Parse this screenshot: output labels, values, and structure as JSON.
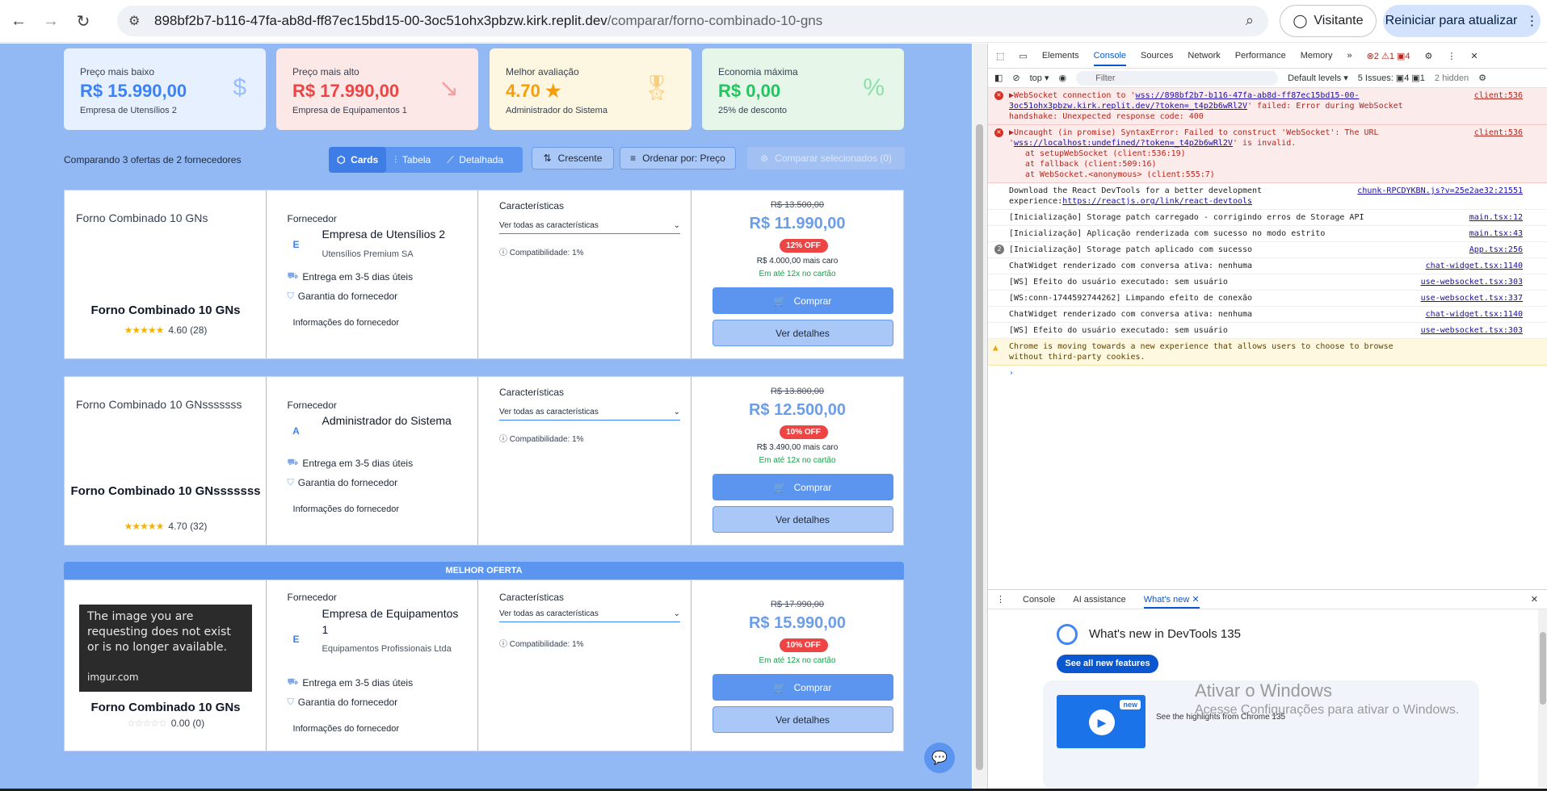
{
  "browser": {
    "url_host": "898bf2b7-b116-47fa-ab8d-ff87ec15bd15-00-3oc51ohx3pbzw.kirk.replit.dev",
    "url_path": "/comparar/forno-combinado-10-gns",
    "visitor_label": "Visitante",
    "restart_label": "Reiniciar para atualizar"
  },
  "stats": [
    {
      "label": "Preço mais baixo",
      "value": "R$ 15.990,00",
      "sub": "Empresa de Utensílios 2",
      "icon": "$",
      "color": "#3b82f6",
      "bg": "#e7f0fe"
    },
    {
      "label": "Preço mais alto",
      "value": "R$ 17.990,00",
      "sub": "Empresa de Equipamentos 1",
      "icon": "↘",
      "color": "#ef4444",
      "bg": "#fde8e8"
    },
    {
      "label": "Melhor avaliação",
      "value": "4.70 ★",
      "sub": "Administrador do Sistema",
      "icon": "🎖",
      "color": "#f59e0b",
      "bg": "#fdf6e0"
    },
    {
      "label": "Economia máxima",
      "value": "R$ 0,00",
      "sub": "25% de desconto",
      "icon": "%",
      "color": "#22c55e",
      "bg": "#e6f7ea"
    }
  ],
  "toolbar": {
    "summary": "Comparando 3 ofertas de 2 fornecedores",
    "view_cards": "Cards",
    "view_table": "Tabela",
    "view_detailed": "Detalhada",
    "sort_dir": "Crescente",
    "sort_by": "Ordenar por: Preço",
    "compare_selected": "Comparar selecionados (0)"
  },
  "labels": {
    "supplier": "Fornecedor",
    "characteristics": "Características",
    "see_all_chars": "Ver todas as características",
    "delivery": "Entrega em 3-5 dias úteis",
    "warranty": "Garantia do fornecedor",
    "supplier_info": "Informações do fornecedor",
    "buy": "Comprar",
    "details": "Ver detalhes",
    "best_offer": "MELHOR OFERTA"
  },
  "offers": [
    {
      "img_alt": "Forno Combinado 10 GNs",
      "name": "Forno Combinado 10 GNs",
      "rating": "4.60 (28)",
      "rating_value": 4.6,
      "initial": "E",
      "company": "Empresa de Utensílios 2",
      "company_sub": "Utensílios Premium SA",
      "compat": "Compatibilidade: 1%",
      "old_price": "R$ 13.500,00",
      "price": "R$ 11.990,00",
      "off": "12% OFF",
      "diff": "R$ 4.000,00 mais caro",
      "installments": "Em até 12x no cartão"
    },
    {
      "img_alt": "Forno Combinado 10 GNsssssss",
      "name": "Forno Combinado 10 GNsssssss",
      "rating": "4.70 (32)",
      "rating_value": 4.7,
      "initial": "A",
      "company": "Administrador do Sistema",
      "company_sub": "",
      "compat": "Compatibilidade: 1%",
      "old_price": "R$ 13.800,00",
      "price": "R$ 12.500,00",
      "off": "10% OFF",
      "diff": "R$ 3.490,00 mais caro",
      "installments": "Em até 12x no cartão"
    },
    {
      "img_text": "The image you are requesting does not exist or is no longer available.",
      "img_site": "imgur.com",
      "name": "Forno Combinado 10 GNs",
      "rating": "0.00 (0)",
      "rating_value": 0,
      "initial": "E",
      "company": "Empresa de Equipamentos 1",
      "company_sub": "Equipamentos Profissionais Ltda",
      "compat": "Compatibilidade: 1%",
      "old_price": "R$ 17.990,00",
      "price": "R$ 15.990,00",
      "off": "10% OFF",
      "installments": "Em até 12x no cartão"
    }
  ],
  "devtools": {
    "tabs": [
      "Elements",
      "Console",
      "Sources",
      "Network",
      "Performance",
      "Memory"
    ],
    "counts": "⊗2 ⚠1 ▣4",
    "context": "top",
    "filter_placeholder": "Filter",
    "levels": "Default levels",
    "issues": "5 Issues: ▣4 ▣1",
    "hidden": "2 hidden",
    "logs": [
      {
        "type": "err",
        "text": "▶WebSocket connection to '",
        "link": "wss://898bf2b7-b116-47fa-ab8d-ff87ec15bd15-00-3oc51ohx3pbzw.kirk.replit.dev/?token=_t4p2b6wRl2V",
        "text2": "' failed: Error during WebSocket handshake: Unexpected response code: 400",
        "src": "client:536"
      },
      {
        "type": "err",
        "text": "▶Uncaught (in promise) SyntaxError: Failed to construct 'WebSocket': The URL '",
        "link": "wss://localhost:undefined/?token=_t4p2b6wRl2V",
        "text2": "' is invalid.",
        "stack": [
          "at setupWebSocket (client:536:19)",
          "at fallback (client:509:16)",
          "at WebSocket.<anonymous> (client:555:7)"
        ],
        "src": "client:536"
      },
      {
        "type": "info",
        "text": "Download the React DevTools for a better development experience:",
        "link": "https://reactjs.org/link/react-devtools",
        "src": "chunk-RPCDYKBN.js?v=25e2ae32:21551"
      },
      {
        "type": "info",
        "text": "[Inicialização] Storage patch carregado - corrigindo erros de Storage API",
        "src": "main.tsx:12"
      },
      {
        "type": "info",
        "text": "[Inicialização] Aplicação renderizada com sucesso no modo estrito",
        "src": "main.tsx:43"
      },
      {
        "type": "info",
        "badge": "2",
        "text": "[Inicialização] Storage patch aplicado com sucesso",
        "src": "App.tsx:256"
      },
      {
        "type": "info",
        "text": "ChatWidget renderizado com conversa ativa: nenhuma",
        "src": "chat-widget.tsx:1140"
      },
      {
        "type": "info",
        "text": "[WS] Efeito do usuário executado: sem usuário",
        "src": "use-websocket.tsx:303"
      },
      {
        "type": "info",
        "text": "[WS:conn-1744592744262] Limpando efeito de conexão",
        "src": "use-websocket.tsx:337"
      },
      {
        "type": "info",
        "text": "ChatWidget renderizado com conversa ativa: nenhuma",
        "src": "chat-widget.tsx:1140"
      },
      {
        "type": "info",
        "text": "[WS] Efeito do usuário executado: sem usuário",
        "src": "use-websocket.tsx:303"
      },
      {
        "type": "warn",
        "text": "Chrome is moving towards a new experience that allows users to choose to browse without third-party cookies.",
        "src": ""
      }
    ],
    "drawer_tabs": [
      "Console",
      "AI assistance",
      "What's new"
    ],
    "whats_new_title": "What's new in DevTools 135",
    "see_all": "See all new features",
    "highlights": "See the highlights from Chrome 135",
    "new_badge": "new",
    "watermark_1": "Ativar o Windows",
    "watermark_2": "Acesse Configurações para ativar o Windows."
  }
}
